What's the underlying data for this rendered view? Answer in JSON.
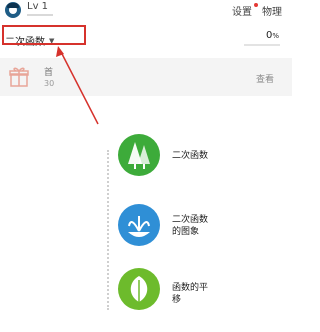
{
  "header": {
    "level": "Lv 1",
    "level_progress": 0,
    "settings_label": "设置",
    "subject_label": "物理"
  },
  "course": {
    "selected": "二次函数",
    "progress_text": "0",
    "progress_unit": "%",
    "progress_fraction": 0
  },
  "gift_banner": {
    "title": "首",
    "subtitle": "30",
    "view_label": "查看"
  },
  "lessons": [
    {
      "label": "二次函数",
      "icon": "trees-icon",
      "color": "#3dab3a"
    },
    {
      "label_line1": "二次函数",
      "label_line2": "的图象",
      "icon": "fountain-icon",
      "color": "#2f8fd6"
    },
    {
      "label_line1": "函数的平",
      "label_line2": "移",
      "icon": "leaf-icon",
      "color": "#6dbb2c"
    }
  ],
  "colors": {
    "highlight": "#d6322c",
    "accent": "#3aa0e0"
  }
}
